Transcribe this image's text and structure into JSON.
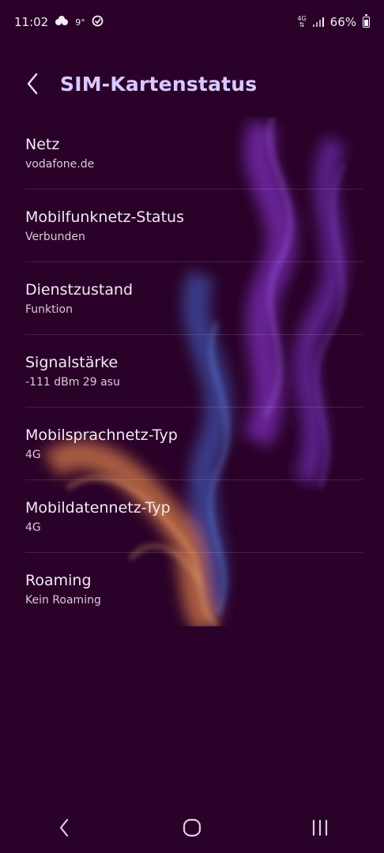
{
  "status_bar": {
    "time": "11:02",
    "temperature": "9°",
    "network_type": "4G",
    "battery_percent": "66%",
    "icons": [
      "cloud-icon",
      "check-circle-icon",
      "data-arrows-icon",
      "signal-icon",
      "battery-icon"
    ]
  },
  "header": {
    "title": "SIM-Kartenstatus"
  },
  "rows": [
    {
      "title": "Netz",
      "value": "vodafone.de"
    },
    {
      "title": "Mobilfunknetz-Status",
      "value": "Verbunden"
    },
    {
      "title": "Dienstzustand",
      "value": "Funktion"
    },
    {
      "title": "Signalstärke",
      "value": "-111 dBm 29 asu"
    },
    {
      "title": "Mobilsprachnetz-Typ",
      "value": "4G"
    },
    {
      "title": "Mobildatennetz-Typ",
      "value": "4G"
    },
    {
      "title": "Roaming",
      "value": "Kein Roaming"
    }
  ],
  "colors": {
    "background": "#2a0128",
    "title_accent": "#d9c8ff",
    "smoke_purple": "#8a3bd0",
    "smoke_blue": "#4a6fc8",
    "smoke_orange": "#e3945a"
  },
  "nav_bar": {
    "icons": [
      "back-icon",
      "home-icon",
      "recents-icon"
    ]
  }
}
